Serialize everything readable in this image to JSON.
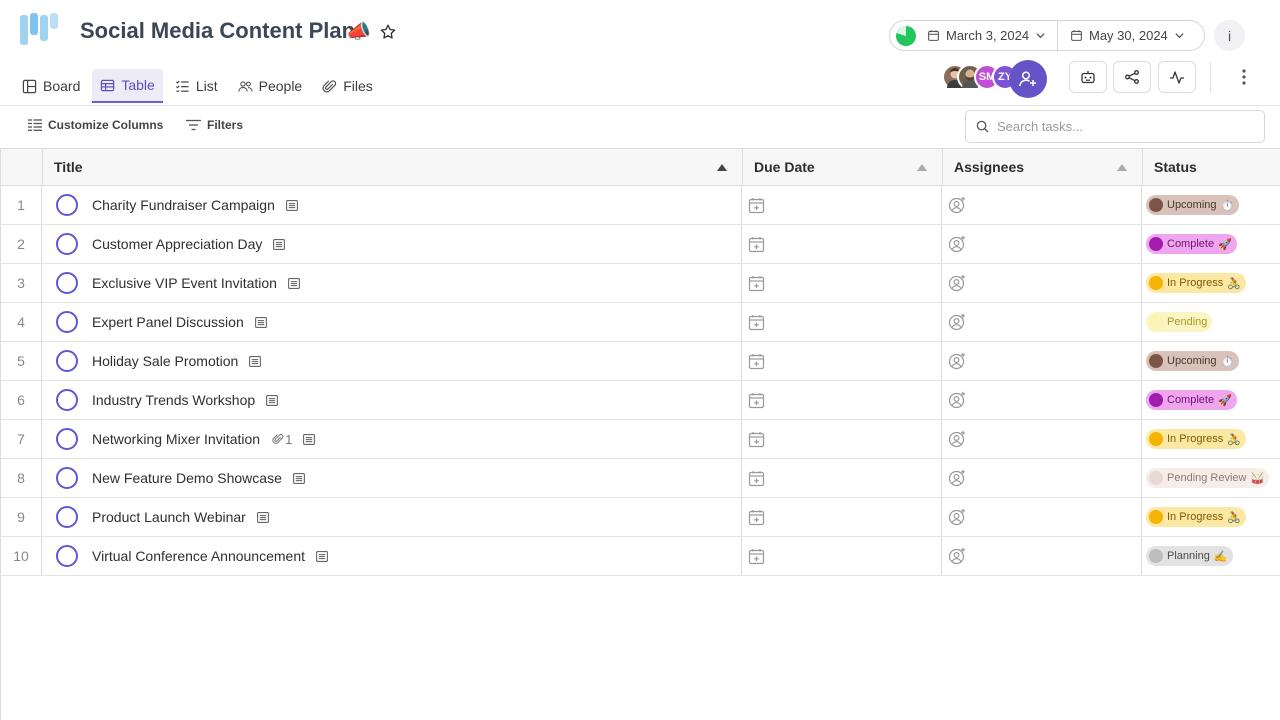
{
  "header": {
    "title": "Social Media Content Plan",
    "title_emoji": "📣",
    "start_date": "March 3, 2024",
    "end_date": "May 30, 2024",
    "info_label": "i",
    "progress_color": "#22c55e"
  },
  "tabs": [
    {
      "label": "Board",
      "icon": "board-icon",
      "active": false
    },
    {
      "label": "Table",
      "icon": "table-icon",
      "active": true
    },
    {
      "label": "List",
      "icon": "list-icon",
      "active": false
    },
    {
      "label": "People",
      "icon": "people-icon",
      "active": false
    },
    {
      "label": "Files",
      "icon": "paperclip-icon",
      "active": false
    }
  ],
  "avatars": [
    {
      "initials": "",
      "color": "#8a6d5a"
    },
    {
      "initials": "",
      "color": "#6f5d4e"
    },
    {
      "initials": "SM",
      "color": "#c04fd6"
    },
    {
      "initials": "ZY",
      "color": "#7c55d6"
    }
  ],
  "toolbar": {
    "customize_label": "Customize Columns",
    "filters_label": "Filters",
    "search_placeholder": "Search tasks..."
  },
  "columns": {
    "title": "Title",
    "due": "Due Date",
    "assignees": "Assignees",
    "status": "Status"
  },
  "rows": [
    {
      "num": "1",
      "title": "Charity Fundraiser Campaign",
      "attachments": "",
      "status": "Upcoming",
      "emoji": "⏱️",
      "dot": "#7a5548",
      "bg": "#d9c2b9",
      "fg": "#4a3730"
    },
    {
      "num": "2",
      "title": "Customer Appreciation Day",
      "attachments": "",
      "status": "Complete",
      "emoji": "🚀",
      "dot": "#a21caf",
      "bg": "#f0a5ef",
      "fg": "#6b1670"
    },
    {
      "num": "3",
      "title": "Exclusive VIP Event Invitation",
      "attachments": "",
      "status": "In Progress",
      "emoji": "🚴",
      "dot": "#f5b400",
      "bg": "#fce7a3",
      "fg": "#7a5b00"
    },
    {
      "num": "4",
      "title": "Expert Panel Discussion",
      "attachments": "",
      "status": "Pending",
      "emoji": "",
      "dot": "#fbf3b4",
      "bg": "#fbf5c3",
      "fg": "#a99826"
    },
    {
      "num": "5",
      "title": "Holiday Sale Promotion",
      "attachments": "",
      "status": "Upcoming",
      "emoji": "⏱️",
      "dot": "#7a5548",
      "bg": "#d9c2b9",
      "fg": "#4a3730"
    },
    {
      "num": "6",
      "title": "Industry Trends Workshop",
      "attachments": "",
      "status": "Complete",
      "emoji": "🚀",
      "dot": "#a21caf",
      "bg": "#f0a5ef",
      "fg": "#6b1670"
    },
    {
      "num": "7",
      "title": "Networking Mixer Invitation",
      "attachments": "1",
      "status": "In Progress",
      "emoji": "🚴",
      "dot": "#f5b400",
      "bg": "#fce7a3",
      "fg": "#7a5b00"
    },
    {
      "num": "8",
      "title": "New Feature Demo Showcase",
      "attachments": "",
      "status": "Pending Review",
      "emoji": "🥁",
      "dot": "#e7d9d2",
      "bg": "#f6ece8",
      "fg": "#8a7a72"
    },
    {
      "num": "9",
      "title": "Product Launch Webinar",
      "attachments": "",
      "status": "In Progress",
      "emoji": "🚴",
      "dot": "#f5b400",
      "bg": "#fce7a3",
      "fg": "#7a5b00"
    },
    {
      "num": "10",
      "title": "Virtual Conference Announcement",
      "attachments": "",
      "status": "Planning",
      "emoji": "✍️",
      "dot": "#bdbdbd",
      "bg": "#e2e2e2",
      "fg": "#4a4a4a"
    }
  ]
}
